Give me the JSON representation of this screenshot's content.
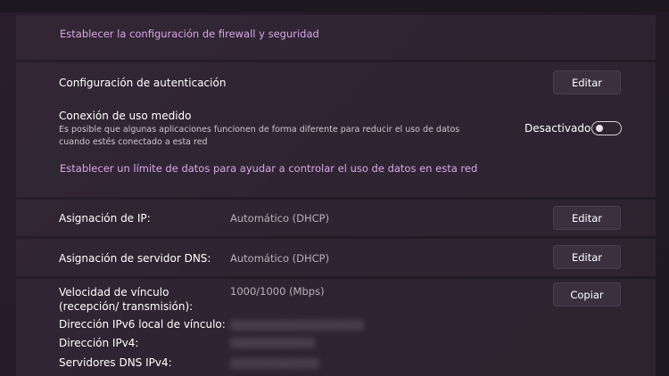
{
  "firewall_link": "Establecer la configuración de firewall y seguridad",
  "auth": {
    "label": "Configuración de autenticación",
    "button": "Editar"
  },
  "metered": {
    "label": "Conexión de uso medido",
    "description": "Es posible que algunas aplicaciones funcionen de forma diferente para reducir el uso de datos cuando estés conectado a esta red",
    "state_label": "Desactivado",
    "enabled": false,
    "data_limit_link": "Establecer un límite de datos para ayudar a controlar el uso de datos en esta red"
  },
  "ip": {
    "label": "Asignación de IP:",
    "value": "Automático (DHCP)",
    "button": "Editar"
  },
  "dns": {
    "label": "Asignación de servidor DNS:",
    "value": "Automático (DHCP)",
    "button": "Editar"
  },
  "properties": {
    "link_speed_label": "Velocidad de vínculo (recepción/ transmisión):",
    "link_speed_value": "1000/1000 (Mbps)",
    "copy_button": "Copiar",
    "ipv6_label": "Dirección IPv6 local de vínculo:",
    "ipv4_label": "Dirección IPv4:",
    "dns_ipv4_label": "Servidores DNS IPv4:"
  },
  "colors": {
    "link": "#d8a8e6",
    "background": "#231b27",
    "panel": "#3a2e3c"
  }
}
